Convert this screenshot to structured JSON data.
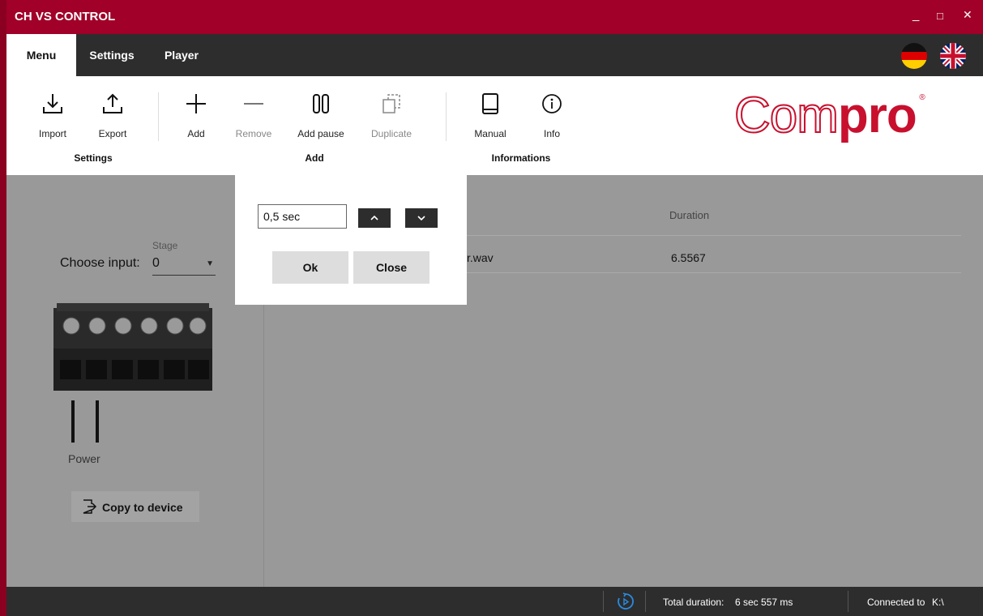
{
  "window": {
    "title": "CH VS CONTROL",
    "minimize": "_",
    "maximize": "□",
    "close": "✕"
  },
  "tabs": [
    {
      "label": "Menu",
      "active": true
    },
    {
      "label": "Settings",
      "active": false
    },
    {
      "label": "Player",
      "active": false
    }
  ],
  "languages": [
    {
      "icon": "flag-de-icon"
    },
    {
      "icon": "flag-uk-icon"
    }
  ],
  "ribbon": {
    "groups": [
      {
        "label": "Settings"
      },
      {
        "label": "Add"
      },
      {
        "label": "Informations"
      }
    ],
    "buttons": {
      "import": {
        "label": "Import",
        "icon": "import-icon"
      },
      "export": {
        "label": "Export",
        "icon": "export-icon"
      },
      "add": {
        "label": "Add",
        "icon": "plus-icon"
      },
      "remove": {
        "label": "Remove",
        "icon": "minus-icon",
        "disabled": true
      },
      "add_pause": {
        "label": "Add pause",
        "icon": "pause-icon"
      },
      "duplicate": {
        "label": "Duplicate",
        "icon": "duplicate-icon",
        "disabled": true
      },
      "manual": {
        "label": "Manual",
        "icon": "book-icon"
      },
      "info": {
        "label": "Info",
        "icon": "info-icon"
      }
    },
    "logo": {
      "part1": "Com",
      "part2": "pro",
      "mark": "®"
    }
  },
  "left_panel": {
    "stage_label": "Stage",
    "choose_input_label": "Choose input:",
    "selected_input": "0",
    "power_label": "Power",
    "copy_button": "Copy to device"
  },
  "table": {
    "columns": {
      "duration": "Duration"
    },
    "rows": [
      {
        "file": "r.wav",
        "duration": "6.5567"
      }
    ]
  },
  "dialog": {
    "value": "0,5 sec",
    "up": "^",
    "down": "⌄",
    "ok": "Ok",
    "close": "Close"
  },
  "status": {
    "total_label": "Total duration:",
    "total_value": "6 sec  557 ms",
    "connected_label": "Connected to",
    "connected_value": "K:\\"
  },
  "colors": {
    "accent": "#a10028",
    "dark": "#2d2d2d",
    "brand": "#c8102e"
  }
}
